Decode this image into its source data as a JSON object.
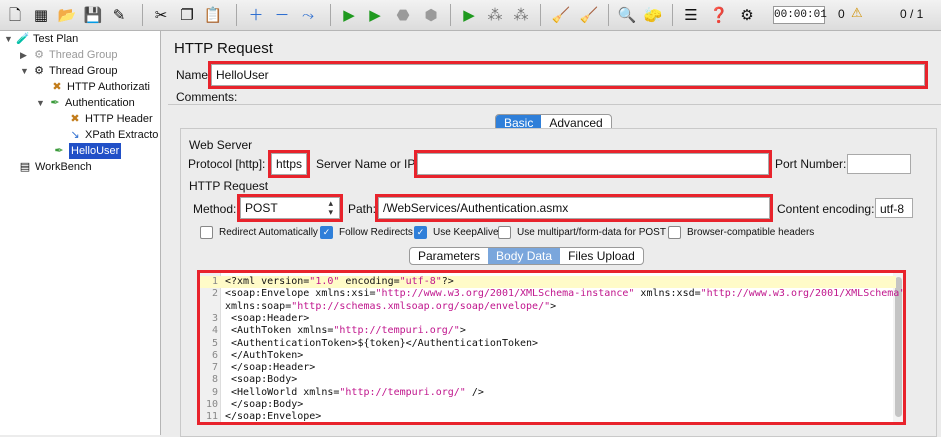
{
  "toolbar": {
    "timer": "00:00:01",
    "errors": "0",
    "warning_icon": "warning-icon",
    "threads": "0 / 1"
  },
  "tree": {
    "test_plan": "Test Plan",
    "thread_group_disabled": "Thread Group",
    "thread_group": "Thread Group",
    "http_authorization": "HTTP Authorizati",
    "authentication": "Authentication",
    "http_header": "HTTP Header",
    "xpath_extractor": "XPath Extracto",
    "hello_user": "HelloUser",
    "workbench": "WorkBench"
  },
  "form": {
    "title": "HTTP Request",
    "name_label": "Name:",
    "name_value": "HelloUser",
    "comments_label": "Comments:",
    "tab_basic": "Basic",
    "tab_advanced": "Advanced",
    "web_server_label": "Web Server",
    "protocol_label": "Protocol [http]:",
    "protocol_value": "https",
    "server_label": "Server Name or IP:",
    "server_value": "",
    "port_label": "Port Number:",
    "port_value": "",
    "http_request_group": "HTTP Request",
    "method_label": "Method:",
    "method_value": "POST",
    "path_label": "Path:",
    "path_value": "/WebServices/Authentication.asmx",
    "encoding_label": "Content encoding:",
    "encoding_value": "utf-8",
    "checkboxes": [
      {
        "label": "Redirect Automatically",
        "checked": false
      },
      {
        "label": "Follow Redirects",
        "checked": true
      },
      {
        "label": "Use KeepAlive",
        "checked": true
      },
      {
        "label": "Use multipart/form-data for POST",
        "checked": false
      },
      {
        "label": "Browser-compatible headers",
        "checked": false
      }
    ],
    "tab_parameters": "Parameters",
    "tab_body_data": "Body Data",
    "tab_files_upload": "Files Upload"
  },
  "body": {
    "lines": [
      {
        "n": "1",
        "a": "<?xml version=",
        "b": "\"1.0\"",
        "c": " encoding=",
        "d": "\"utf-8\"",
        "e": "?>"
      },
      {
        "n": "2",
        "a": "<soap:Envelope xmlns:xsi=",
        "b": "\"http://www.w3.org/2001/XMLSchema-instance\"",
        "c": " xmlns:xsd=",
        "d": "\"http://www.w3.org/2001/XMLSchema\"",
        "e": ""
      },
      {
        "n": "",
        "a": "xmlns:soap=",
        "b": "\"http://schemas.xmlsoap.org/soap/envelope/\"",
        "c": ">",
        "d": "",
        "e": ""
      },
      {
        "n": "3",
        "a": "  <soap:Header>",
        "b": "",
        "c": "",
        "d": "",
        "e": ""
      },
      {
        "n": "4",
        "a": "    <AuthToken xmlns=",
        "b": "\"http://tempuri.org/\"",
        "c": ">",
        "d": "",
        "e": ""
      },
      {
        "n": "5",
        "a": "      <AuthenticationToken>${token}</AuthenticationToken>",
        "b": "",
        "c": "",
        "d": "",
        "e": ""
      },
      {
        "n": "6",
        "a": "    </AuthToken>",
        "b": "",
        "c": "",
        "d": "",
        "e": ""
      },
      {
        "n": "7",
        "a": "  </soap:Header>",
        "b": "",
        "c": "",
        "d": "",
        "e": ""
      },
      {
        "n": "8",
        "a": "  <soap:Body>",
        "b": "",
        "c": "",
        "d": "",
        "e": ""
      },
      {
        "n": "9",
        "a": "    <HelloWorld xmlns=",
        "b": "\"http://tempuri.org/\"",
        "c": " />",
        "d": "",
        "e": ""
      },
      {
        "n": "10",
        "a": "  </soap:Body>",
        "b": "",
        "c": "",
        "d": "",
        "e": ""
      },
      {
        "n": "11",
        "a": "</soap:Envelope>",
        "b": "",
        "c": "",
        "d": "",
        "e": ""
      }
    ]
  },
  "colors": {
    "highlight": "#e8232c",
    "selection": "#2150c7",
    "tab_active": "#2f7fd9",
    "xml_value": "#c0168d"
  }
}
